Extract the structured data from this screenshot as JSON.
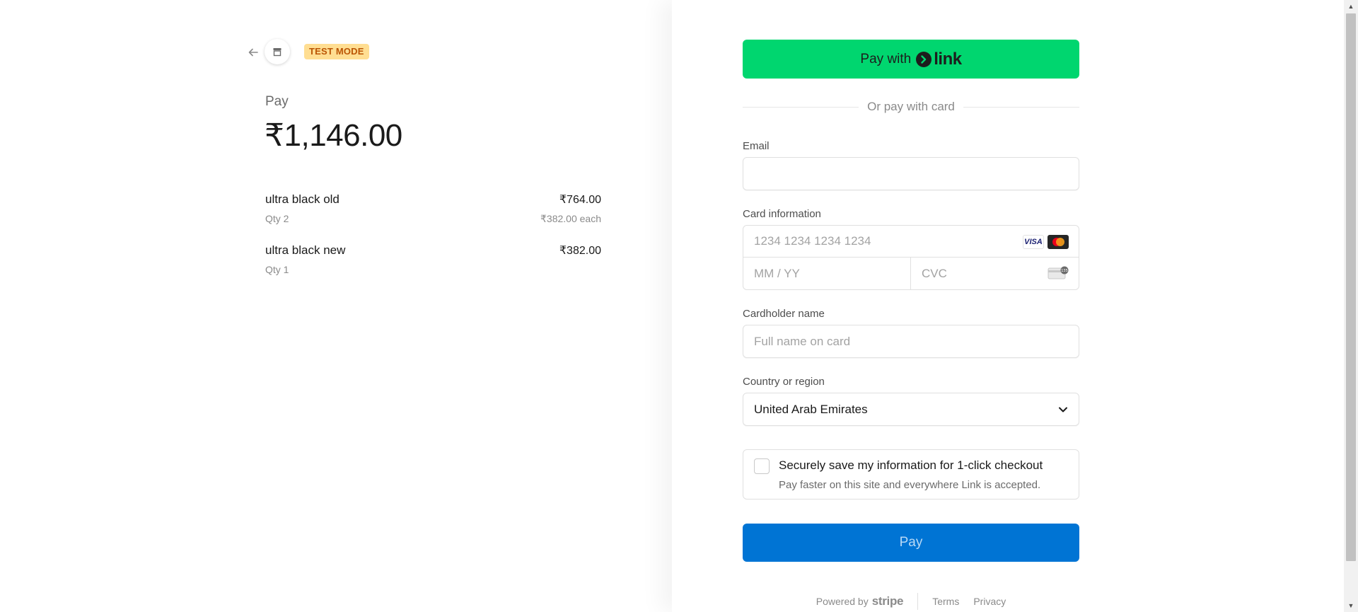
{
  "summary": {
    "test_mode_badge": "TEST MODE",
    "pay_label": "Pay",
    "total": "₹1,146.00",
    "items": [
      {
        "name": "ultra black old",
        "price": "₹764.00",
        "qty": "Qty 2",
        "each": "₹382.00 each"
      },
      {
        "name": "ultra black new",
        "price": "₹382.00",
        "qty": "Qty 1",
        "each": ""
      }
    ]
  },
  "checkout": {
    "link_button": {
      "prefix": "Pay with",
      "brand": "link"
    },
    "divider_text": "Or pay with card",
    "email": {
      "label": "Email",
      "value": "",
      "placeholder": ""
    },
    "card": {
      "label": "Card information",
      "number_placeholder": "1234 1234 1234 1234",
      "expiry_placeholder": "MM / YY",
      "cvc_placeholder": "CVC",
      "brands": [
        "VISA",
        "mastercard"
      ]
    },
    "cardholder": {
      "label": "Cardholder name",
      "placeholder": "Full name on card"
    },
    "country": {
      "label": "Country or region",
      "selected": "United Arab Emirates"
    },
    "save_info": {
      "checked": false,
      "title": "Securely save my information for 1-click checkout",
      "subtitle": "Pay faster on this site and everywhere Link is accepted."
    },
    "pay_button": "Pay",
    "footer": {
      "powered_by": "Powered by",
      "brand": "stripe",
      "terms": "Terms",
      "privacy": "Privacy"
    }
  },
  "colors": {
    "link_green": "#00d66f",
    "pay_blue": "#0074d4",
    "test_badge_bg": "#ffde92",
    "test_badge_text": "#bb5504"
  },
  "icons": {
    "back": "arrow-left-icon",
    "store": "store-icon",
    "link_mark": "link-chevron-icon",
    "select": "chevron-down-icon",
    "cvc": "card-cvc-icon"
  }
}
